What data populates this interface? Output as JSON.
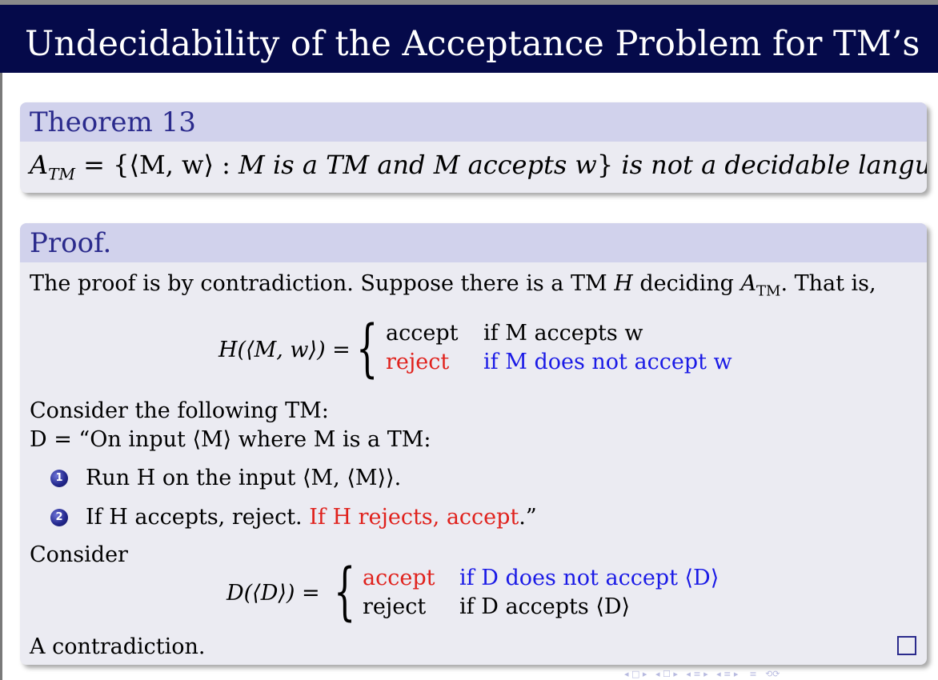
{
  "slide": {
    "title": "Undecidability of the Acceptance Problem for TM’s"
  },
  "theorem": {
    "heading": "Theorem 13",
    "lhs": "A",
    "lhs_sub": "TM",
    "eq_open": " = {⟨M, w⟩ : ",
    "cond": "M is a TM and M accepts w",
    "close": "}",
    "rest": " is not a decidable language."
  },
  "proof": {
    "heading": "Proof.",
    "intro_a": "The proof is by contradiction. Suppose there is a TM ",
    "intro_H": "H",
    "intro_b": " deciding ",
    "intro_A": "A",
    "intro_sub": "TM",
    "intro_c": ". That is,",
    "h_lhs": "H(⟨M, w⟩) =",
    "h_case1_val": "accept",
    "h_case1_cond": "if M accepts w",
    "h_case2_val": "reject",
    "h_case2_cond": "if M does not accept w",
    "consider_tm": "Consider the following TM:",
    "d_def": "D = “On input ⟨M⟩ where M is a TM:",
    "steps": [
      {
        "num": "1",
        "text": "Run H on the input ⟨M, ⟨M⟩⟩."
      },
      {
        "num": "2",
        "text_a": "If H accepts, reject. ",
        "text_red": "If H rejects, accept",
        "text_end": ".”"
      }
    ],
    "consider": "Consider",
    "d_lhs": "D(⟨D⟩) =",
    "d_case1_val": "accept",
    "d_case1_cond": "if D does not accept ⟨D⟩",
    "d_case2_val": "reject",
    "d_case2_cond": "if D accepts ⟨D⟩",
    "conclusion": "A contradiction."
  }
}
